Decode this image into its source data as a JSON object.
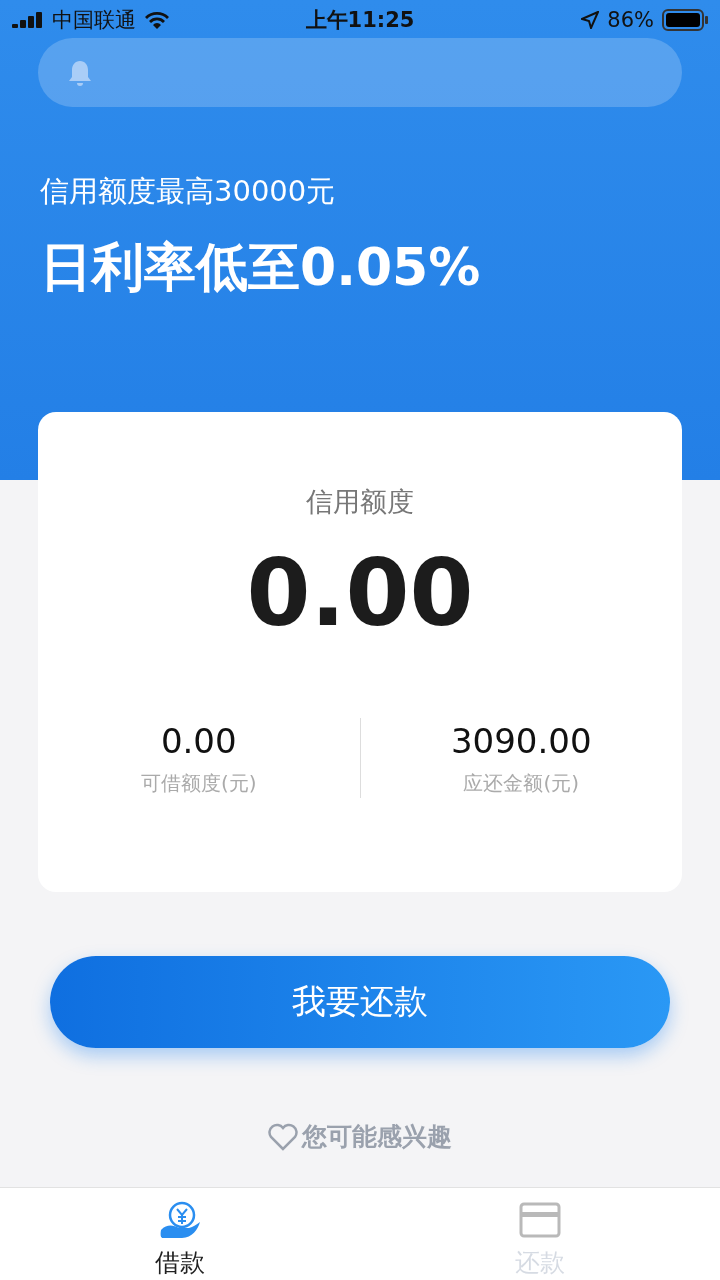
{
  "status_bar": {
    "carrier": "中国联通",
    "time": "上午11:25",
    "battery": "86%"
  },
  "hero": {
    "subtitle": "信用额度最高30000元",
    "headline": "日利率低至0.05%"
  },
  "credit_card": {
    "label": "信用额度",
    "amount": "0.00",
    "stats": [
      {
        "value": "0.00",
        "label": "可借额度(元)"
      },
      {
        "value": "3090.00",
        "label": "应还金额(元)"
      }
    ]
  },
  "primary_button": "我要还款",
  "interest_link": "您可能感兴趣",
  "tabs": [
    {
      "kind": "loan",
      "label": "借款",
      "selected": true
    },
    {
      "kind": "repay",
      "label": "还款",
      "selected": false
    }
  ]
}
